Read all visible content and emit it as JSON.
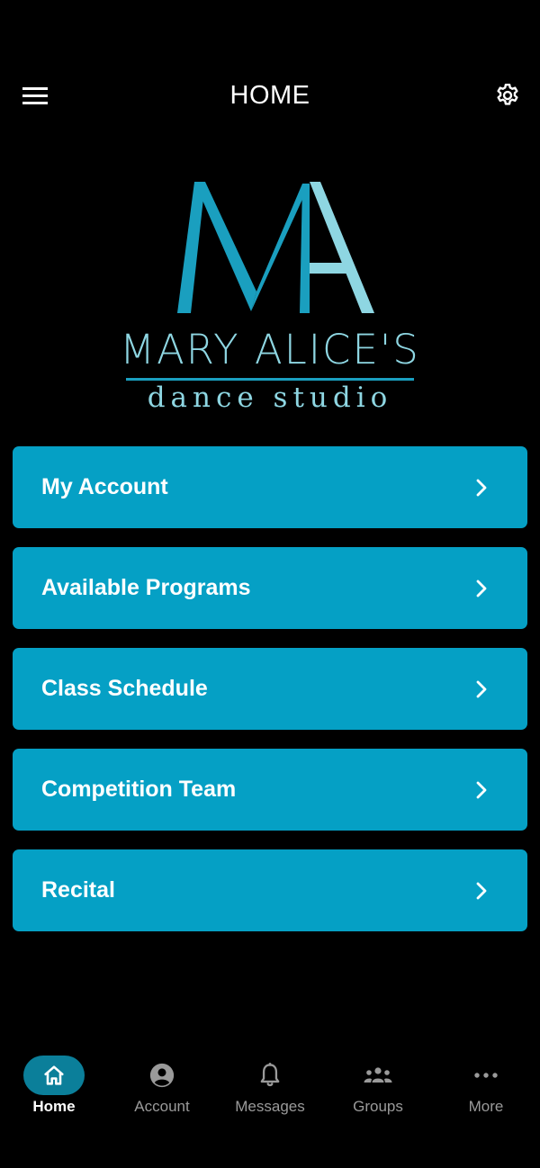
{
  "header": {
    "title": "HOME",
    "menu_icon": "hamburger-menu-icon",
    "settings_icon": "gear-icon"
  },
  "logo": {
    "name": "MARY ALICE'S",
    "subtitle": "dance studio",
    "monogram_colors": [
      "#1a9fbf",
      "#8ed6e2"
    ]
  },
  "menu": {
    "items": [
      {
        "label": "My Account",
        "icon": "chevron-right-icon"
      },
      {
        "label": "Available Programs",
        "icon": "chevron-right-icon"
      },
      {
        "label": "Class Schedule",
        "icon": "chevron-right-icon"
      },
      {
        "label": "Competition Team",
        "icon": "chevron-right-icon"
      },
      {
        "label": "Recital",
        "icon": "chevron-right-icon"
      }
    ]
  },
  "bottom_nav": {
    "items": [
      {
        "label": "Home",
        "icon": "home-icon",
        "active": true
      },
      {
        "label": "Account",
        "icon": "account-circle-icon",
        "active": false
      },
      {
        "label": "Messages",
        "icon": "bell-icon",
        "active": false
      },
      {
        "label": "Groups",
        "icon": "groups-icon",
        "active": false
      },
      {
        "label": "More",
        "icon": "more-dots-icon",
        "active": false
      }
    ]
  },
  "colors": {
    "background": "#000000",
    "card": "#05a0c5",
    "active_nav": "#0b7f9a",
    "logo_light": "#8ed6e2",
    "logo_dark": "#1a9fbf",
    "inactive_nav_text": "#9a9a9a"
  }
}
